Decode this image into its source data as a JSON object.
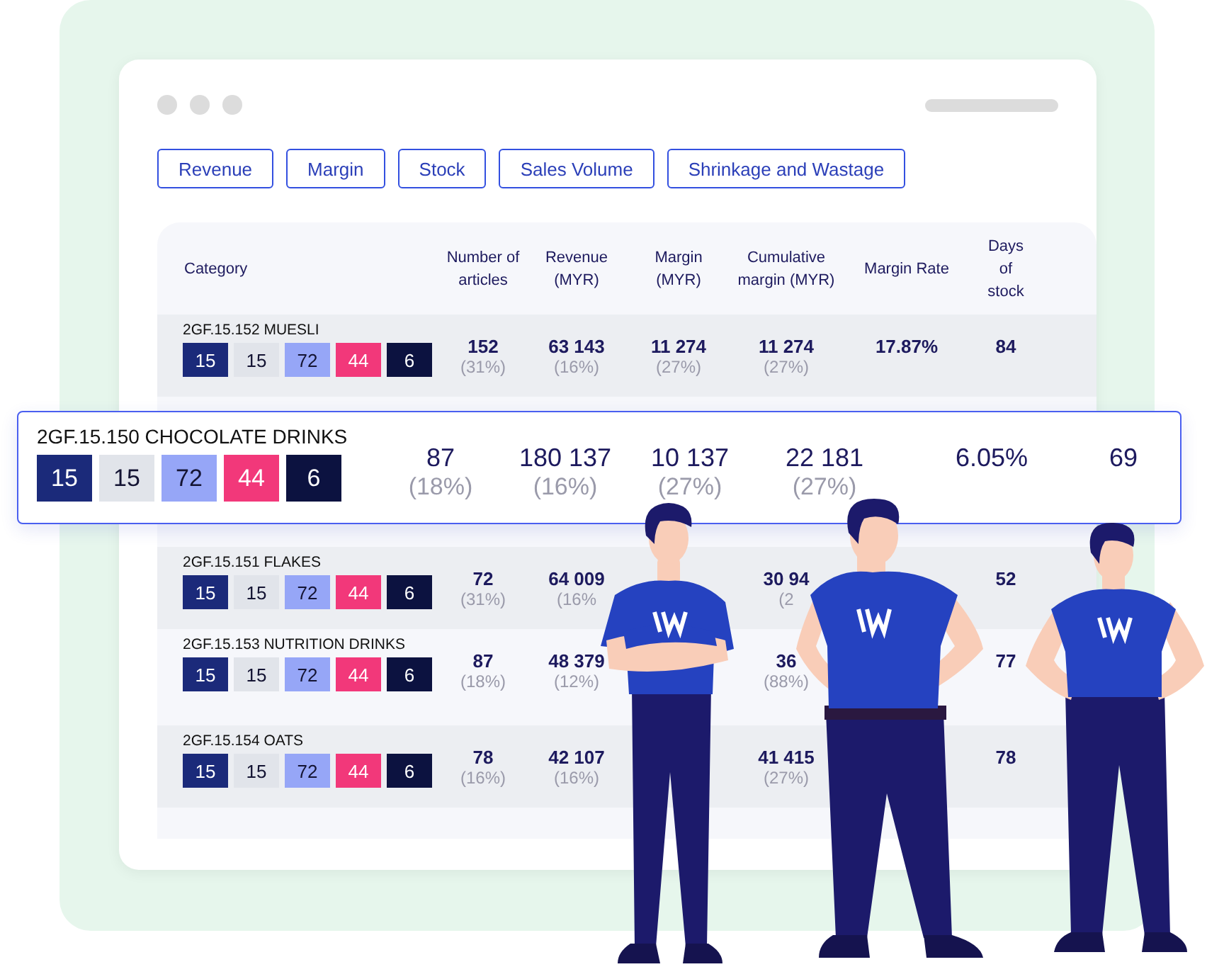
{
  "filter_buttons": [
    "Revenue",
    "Margin",
    "Stock",
    "Sales Volume",
    "Shrinkage and Wastage"
  ],
  "table": {
    "columns": [
      {
        "label": "Category"
      },
      {
        "label": "Number of articles"
      },
      {
        "label": "Revenue (MYR)"
      },
      {
        "label": "Margin (MYR)"
      },
      {
        "label": "Cumulative margin (MYR)"
      },
      {
        "label": "Margin Rate"
      },
      {
        "label": "Days of stock"
      }
    ],
    "rows": [
      {
        "cells": [
          {
            "kind": "category",
            "text": "2GF.15.152 MUESLI",
            "chips": [
              {
                "label": "15",
                "color": "#1b2a7a"
              },
              {
                "label": "15",
                "color": "#e1e4ea"
              },
              {
                "label": "72",
                "color": "#96a6f7"
              },
              {
                "label": "44",
                "color": "#f2387a"
              },
              {
                "label": "6",
                "color": "#0c1240"
              }
            ]
          },
          {
            "kind": "number",
            "value": "152",
            "share": "(31%)"
          },
          {
            "kind": "number",
            "value": "63 143",
            "share": "(16%)"
          },
          {
            "kind": "number",
            "value": "11 274",
            "share": "(27%)"
          },
          {
            "kind": "number",
            "value": "11 274",
            "share": "(27%)"
          },
          {
            "kind": "number",
            "value": "17.87%"
          },
          {
            "kind": "number",
            "value": "84"
          }
        ]
      },
      {
        "cells": [
          {
            "kind": "category",
            "text": "2GF.15.151 FLAKES",
            "chips": [
              {
                "label": "15",
                "color": "#1b2a7a"
              },
              {
                "label": "15",
                "color": "#e1e4ea"
              },
              {
                "label": "72",
                "color": "#96a6f7"
              },
              {
                "label": "44",
                "color": "#f2387a"
              },
              {
                "label": "6",
                "color": "#0c1240"
              }
            ]
          },
          {
            "kind": "number",
            "value": "72",
            "share": "(31%)"
          },
          {
            "kind": "number",
            "value": "64 009",
            "share": "(16%"
          },
          {
            "kind": "number"
          },
          {
            "kind": "number",
            "value": "30 94",
            "share": "(2"
          },
          {
            "kind": "number"
          },
          {
            "kind": "number",
            "value": "52"
          }
        ]
      },
      {
        "cells": [
          {
            "kind": "category",
            "text": "2GF.15.153 NUTRITION DRINKS",
            "chips": [
              {
                "label": "15",
                "color": "#1b2a7a"
              },
              {
                "label": "15",
                "color": "#e1e4ea"
              },
              {
                "label": "72",
                "color": "#96a6f7"
              },
              {
                "label": "44",
                "color": "#f2387a"
              },
              {
                "label": "6",
                "color": "#0c1240"
              }
            ]
          },
          {
            "kind": "number",
            "value": "87",
            "share": "(18%)"
          },
          {
            "kind": "number",
            "value": "48 379",
            "share": "(12%)"
          },
          {
            "kind": "number"
          },
          {
            "kind": "number",
            "value": "36",
            "share": "(88%)"
          },
          {
            "kind": "number"
          },
          {
            "kind": "number",
            "value": "77"
          }
        ]
      },
      {
        "cells": [
          {
            "kind": "category",
            "text": "2GF.15.154 OATS",
            "chips": [
              {
                "label": "15",
                "color": "#1b2a7a"
              },
              {
                "label": "15",
                "color": "#e1e4ea"
              },
              {
                "label": "72",
                "color": "#96a6f7"
              },
              {
                "label": "44",
                "color": "#f2387a"
              },
              {
                "label": "6",
                "color": "#0c1240"
              }
            ]
          },
          {
            "kind": "number",
            "value": "78",
            "share": "(16%)"
          },
          {
            "kind": "number",
            "value": "42 107",
            "share": "(16%)"
          },
          {
            "kind": "number"
          },
          {
            "kind": "number",
            "value": "41 415",
            "share": "(27%)"
          },
          {
            "kind": "number"
          },
          {
            "kind": "number",
            "value": "78"
          }
        ]
      }
    ]
  },
  "highlighted_row": {
    "cells": [
      {
        "kind": "category",
        "text": "2GF.15.150 CHOCOLATE DRINKS",
        "chips": [
          {
            "label": "15",
            "color": "#1b2a7a"
          },
          {
            "label": "15",
            "color": "#e1e4ea"
          },
          {
            "label": "72",
            "color": "#96a6f7"
          },
          {
            "label": "44",
            "color": "#f2387a"
          },
          {
            "label": "6",
            "color": "#0c1240"
          }
        ]
      },
      {
        "kind": "number",
        "value": "87",
        "share": "(18%)"
      },
      {
        "kind": "number",
        "value": "180 137",
        "share": "(16%)"
      },
      {
        "kind": "number",
        "value": "10 137",
        "share": "(27%)"
      },
      {
        "kind": "number",
        "value": "22 181",
        "share": "(27%)"
      },
      {
        "kind": "number",
        "value": "6.05%"
      },
      {
        "kind": "number",
        "value": "69"
      }
    ]
  }
}
